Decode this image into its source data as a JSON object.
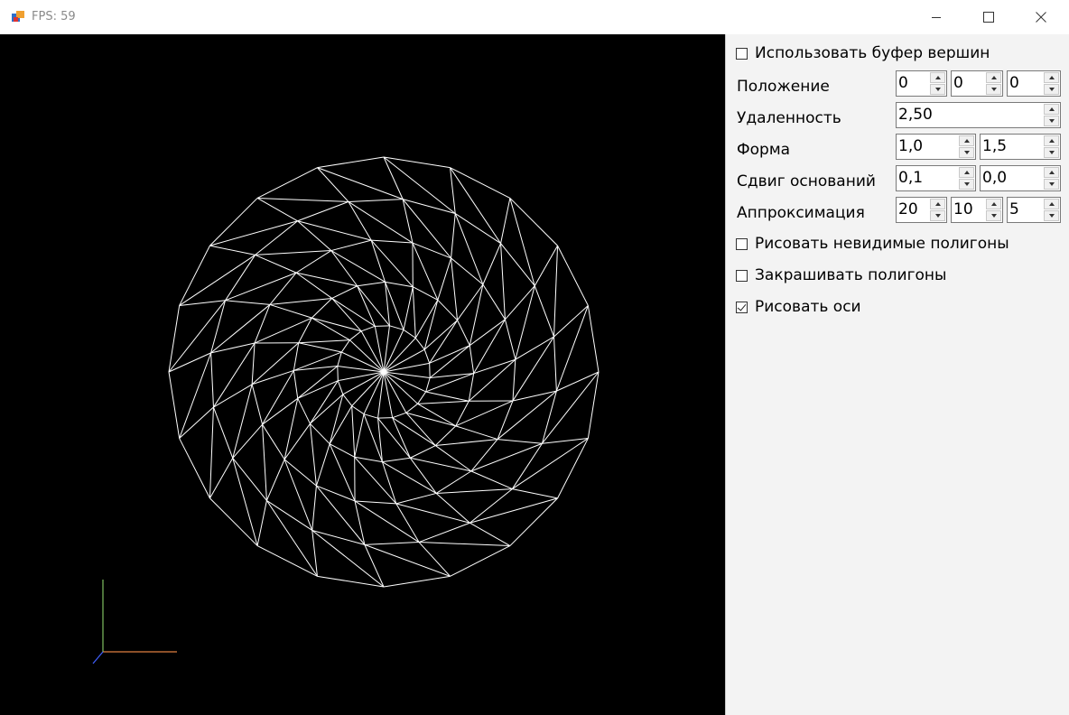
{
  "window": {
    "title": "FPS: 59",
    "title_color": "#8a8a8a"
  },
  "viewport": {
    "background": "#000000",
    "wireframe_color": "#ffffff",
    "axes_colors": {
      "x": "#e08040",
      "y": "#80c060",
      "z": "#4060ff"
    },
    "icon": "wireframe-ellipsoid"
  },
  "panel": {
    "use_vertex_buffer": {
      "label": "Использовать буфер вершин",
      "checked": false
    },
    "position": {
      "label": "Положение",
      "values": [
        "0",
        "0",
        "0"
      ]
    },
    "distance": {
      "label": "Удаленность",
      "value": "2,50"
    },
    "shape": {
      "label": "Форма",
      "values": [
        "1,0",
        "1,5"
      ]
    },
    "base_shift": {
      "label": "Сдвиг оснований",
      "values": [
        "0,1",
        "0,0"
      ]
    },
    "approximation": {
      "label": "Аппроксимация",
      "values": [
        "20",
        "10",
        "5"
      ]
    },
    "draw_hidden": {
      "label": "Рисовать невидимые полигоны",
      "checked": false
    },
    "fill_polygons": {
      "label": "Закрашивать полигоны",
      "checked": false
    },
    "draw_axes": {
      "label": "Рисовать оси",
      "checked": true
    }
  }
}
